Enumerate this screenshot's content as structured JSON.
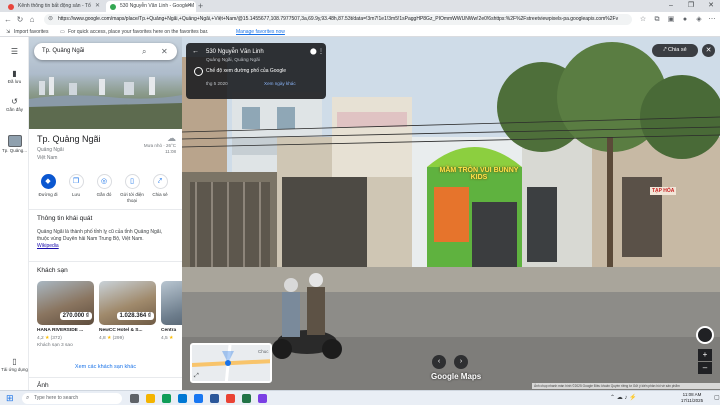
{
  "browser": {
    "tabs": [
      {
        "title": "Kênh thông tin bất động sản - Tổ",
        "color": "#e8453c"
      },
      {
        "title": "530 Nguyễn Văn Linh - Google M",
        "color": "#34a853"
      }
    ],
    "url": "https://www.google.com/maps/place/Tp.+Quảng+Ngãi,+Quảng+Ngãi,+Việt+Nam/@15.1455677,108.7977507,3a,69.9y,93.48h,87.53t/data=!3m7!1e1!3m5!1sPaggHP8Gz_PIOmmWWUNWw!2e0!6shttps:%2F%2Fstreetviewpixels-pa.googleapis.com%2Fv",
    "bookmarks": {
      "import_label": "Import favorites",
      "message": "For quick access, place your favorites here on the favorites bar.",
      "manage_link": "Manage favorites now"
    }
  },
  "rail": {
    "items": [
      {
        "icon": "bookmark-icon",
        "label": "Đã lưu"
      },
      {
        "icon": "history-icon",
        "label": "Gần đây"
      },
      {
        "icon": "place-thumb-icon",
        "label": "Tp. Quảng..."
      },
      {
        "icon": "phone-icon",
        "label": "Tải ứng dụng"
      }
    ]
  },
  "panel": {
    "search_value": "Tp. Quảng Ngãi",
    "title": "Tp. Quảng Ngãi",
    "subtitle1": "Quảng Ngãi",
    "subtitle2": "Việt Nam",
    "weather": {
      "condition": "Mưa nhỏ · 26°C",
      "time": "11:08"
    },
    "actions": [
      {
        "label": "Đường đi",
        "icon": "directions-icon",
        "glyph": "◆"
      },
      {
        "label": "Lưu",
        "icon": "save-icon",
        "glyph": "❐"
      },
      {
        "label": "Gần đó",
        "icon": "nearby-icon",
        "glyph": "◎"
      },
      {
        "label": "Gửi tới điện thoại",
        "icon": "send-to-phone-icon",
        "glyph": "▯"
      },
      {
        "label": "Chia sẻ",
        "icon": "share-icon",
        "glyph": "⤤"
      }
    ],
    "about_heading": "Thông tin khái quát",
    "about_text": "Quảng Ngãi là thành phố tỉnh lỵ cũ của tỉnh Quảng Ngãi, thuộc vùng Duyên hải Nam Trung Bộ, Việt Nam.",
    "about_link": "Wikipedia",
    "hotels_heading": "Khách sạn",
    "hotels": [
      {
        "name": "HANA RIVERSIDE ...",
        "price": "270.000 ₫",
        "rating": "4,2",
        "reviews": "(372)",
        "class": "Khách sạn 3 sao",
        "color": "#7a6a58"
      },
      {
        "name": "NewCC Hotel & S...",
        "price": "1.028.364 ₫",
        "rating": "4,8",
        "reviews": "(299)",
        "class": "",
        "color": "#8f7d63"
      },
      {
        "name": "Centra",
        "price": "",
        "rating": "4,5",
        "reviews": "",
        "class": "",
        "color": "#5c6b7a"
      }
    ],
    "more_hotels": "Xem các khách sạn khác",
    "photos_heading": "Ảnh"
  },
  "streetview": {
    "card_title": "530 Nguyễn Văn Linh",
    "card_address": "Quảng Ngãi, Quảng Ngãi",
    "card_toggle": "Chế độ xem đường phố của Google",
    "card_date": "thg 5 2020",
    "card_more": "Xem ngày khác",
    "share_label": "Chia sẻ",
    "logo": "Google Maps",
    "attribution": "Ảnh chụp nhanh màn hình ©2025 Google   Điều khoản   Quyền riêng tư   Gửi ý kiến phản hồi về sản phẩm",
    "minimap_label": "Chuc",
    "shop_sign": "MẦM TRÒN VUI BUNNY KIDS",
    "shop_sign2": "TẠP HÓA"
  },
  "taskbar": {
    "search_placeholder": "Type here to search",
    "time": "11:08 AM",
    "date": "17/11/2025"
  }
}
